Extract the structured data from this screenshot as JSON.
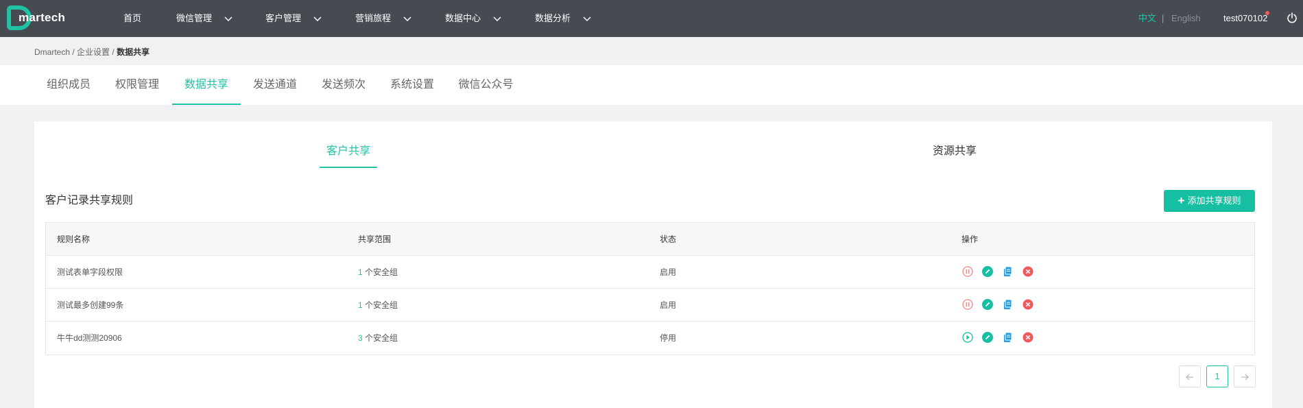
{
  "brand": {
    "logo_text": "martech",
    "accent": "#21c2a4"
  },
  "nav": {
    "items": [
      {
        "label": "首页",
        "has_dropdown": false
      },
      {
        "label": "微信管理",
        "has_dropdown": true
      },
      {
        "label": "客户管理",
        "has_dropdown": true
      },
      {
        "label": "营销旅程",
        "has_dropdown": true
      },
      {
        "label": "数据中心",
        "has_dropdown": true
      },
      {
        "label": "数据分析",
        "has_dropdown": true
      }
    ],
    "lang_zh": "中文",
    "lang_sep": "|",
    "lang_en": "English",
    "user": "test070102"
  },
  "breadcrumb": {
    "root": "Dmartech",
    "sep": " / ",
    "parent": "企业设置",
    "current": "数据共享"
  },
  "subtabs": [
    {
      "label": "组织成员",
      "active": false
    },
    {
      "label": "权限管理",
      "active": false
    },
    {
      "label": "数据共享",
      "active": true
    },
    {
      "label": "发送通道",
      "active": false
    },
    {
      "label": "发送频次",
      "active": false
    },
    {
      "label": "系统设置",
      "active": false
    },
    {
      "label": "微信公众号",
      "active": false
    }
  ],
  "inner_tabs": [
    {
      "label": "客户共享",
      "active": true
    },
    {
      "label": "资源共享",
      "active": false
    }
  ],
  "section": {
    "title": "客户记录共享规则",
    "add_button": "添加共享规则"
  },
  "table": {
    "columns": [
      "规则名称",
      "共享范围",
      "状态",
      "操作"
    ],
    "unit": " 个安全组",
    "rows": [
      {
        "name": "测试表单字段权限",
        "count": "1",
        "status": "启用",
        "toggle": "pause-icon"
      },
      {
        "name": "测试最多创建99条",
        "count": "1",
        "status": "启用",
        "toggle": "pause-icon"
      },
      {
        "name": "牛牛dd测测20906",
        "count": "3",
        "status": "停用",
        "toggle": "play-icon"
      }
    ]
  },
  "pagination": {
    "current_page": "1"
  },
  "colors": {
    "topbar": "#454b51",
    "accent": "#21c2a4",
    "danger": "#f05a5a",
    "blue": "#1e9fe6",
    "pause": "#f08a8a"
  }
}
